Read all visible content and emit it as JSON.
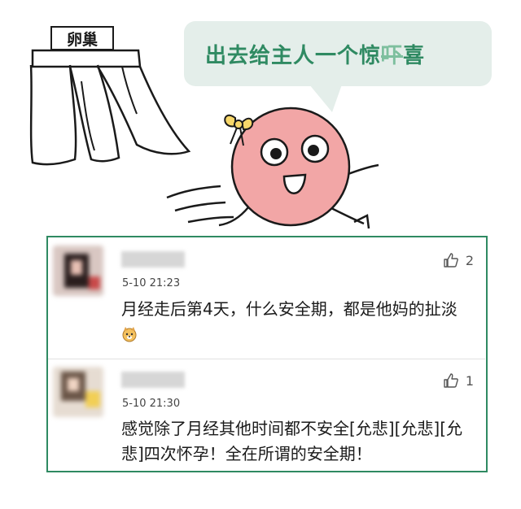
{
  "illustration": {
    "sign_text": "卵巢",
    "bubble": {
      "text_before": "出去给主人一个惊",
      "text_struck": "吓",
      "text_after": "喜"
    }
  },
  "comments": [
    {
      "username": "",
      "time": "5-10 21:23",
      "likes": "2",
      "text": "月经走后第4天，什么安全期，都是他妈的扯淡",
      "emoji": "dog-face-emoji"
    },
    {
      "username": "",
      "time": "5-10 21:30",
      "likes": "1",
      "text": "感觉除了月经其他时间都不安全[允悲][允悲][允悲]四次怀孕！全在所谓的安全期！"
    }
  ],
  "colors": {
    "accent": "#2f8a62",
    "bubble_bg": "#e4eeea",
    "character_pink": "#f2a6a6",
    "bow_yellow": "#f7d76a"
  }
}
